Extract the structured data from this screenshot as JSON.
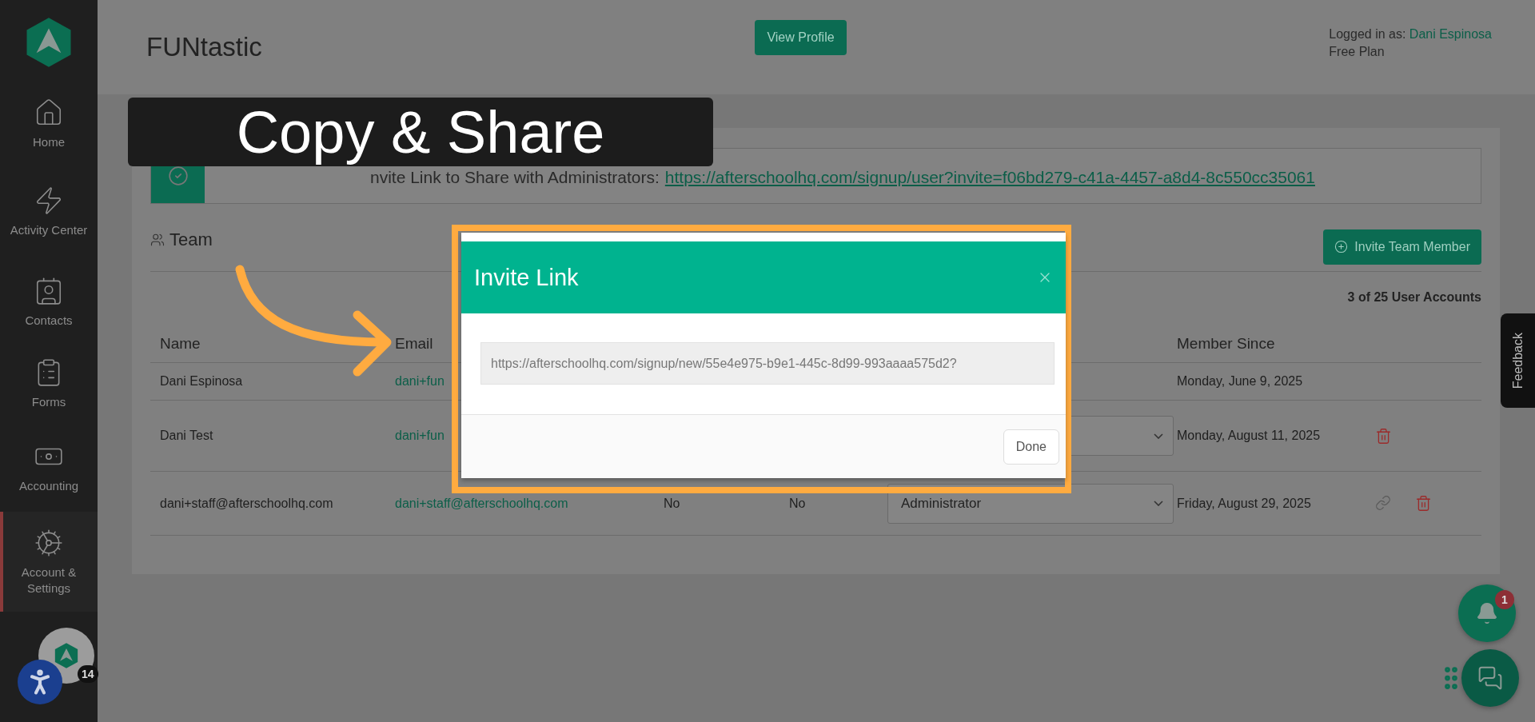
{
  "sidebar": {
    "items": [
      {
        "label": "Home",
        "selected": false
      },
      {
        "label": "Activity Center",
        "selected": false
      },
      {
        "label": "Contacts",
        "selected": false
      },
      {
        "label": "Forms",
        "selected": false
      },
      {
        "label": "Accounting",
        "selected": false
      },
      {
        "label": "Account & Settings",
        "selected": true
      }
    ],
    "badge": "14"
  },
  "header": {
    "title": "FUNtastic",
    "view_profile": "View Profile",
    "logged_in_label": "Logged in as:",
    "user_name": "Dani Espinosa",
    "plan": "Free Plan"
  },
  "callout": {
    "text": "Copy & Share"
  },
  "invite_bar": {
    "label": "nvite Link to Share with Administrators:",
    "link": "https://afterschoolhq.com/signup/user?invite=f06bd279-c41a-4457-a8d4-8c550cc35061"
  },
  "team": {
    "title": "Team",
    "invite_button": "Invite Team Member",
    "count": "3 of 25 User Accounts"
  },
  "table": {
    "columns": [
      {
        "label": "Name"
      },
      {
        "label": "Email"
      },
      {
        "label": "Member Since"
      }
    ],
    "rows": [
      {
        "name": "Dani Espinosa",
        "email": "dani+fun",
        "role_field": false,
        "member_since": "Monday, June 9, 2025",
        "actions": []
      },
      {
        "name": "Dani Test",
        "email": "dani+fun",
        "role_field": true,
        "member_since": "Monday, August 11, 2025",
        "actions": [
          {
            "kind": "delete"
          }
        ]
      },
      {
        "name": "dani+staff@afterschoolhq.com",
        "email": "dani+staff@afterschoolhq.com",
        "column_3": "No",
        "column_4": "No",
        "role_field": true,
        "role": "Administrator",
        "member_since": "Friday, August 29, 2025",
        "actions": [
          {
            "kind": "link"
          },
          {
            "kind": "delete"
          }
        ]
      }
    ]
  },
  "modal": {
    "title": "Invite Link",
    "link": "https://afterschoolhq.com/signup/new/55e4e975-b9e1-445c-8d99-993aaaa575d2?",
    "done": "Done"
  },
  "feedback": "Feedback",
  "notifications": {
    "count": "1"
  }
}
